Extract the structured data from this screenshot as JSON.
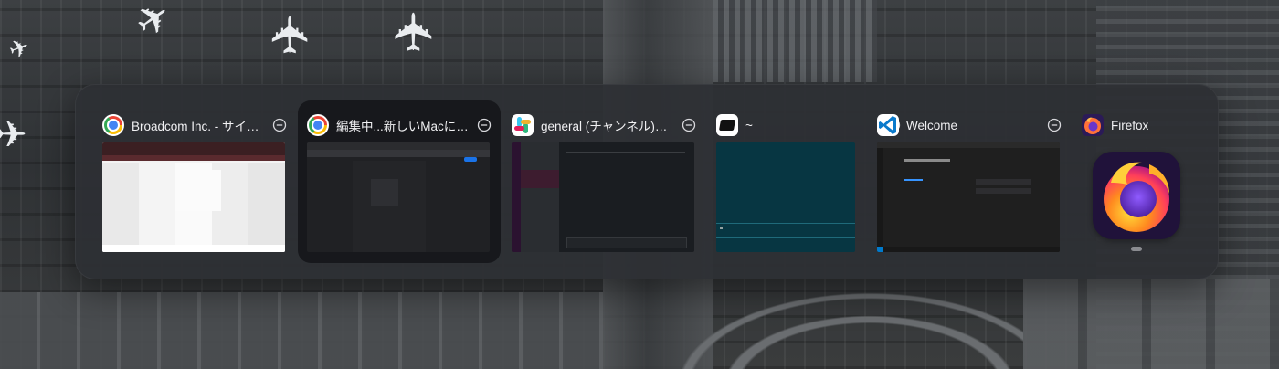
{
  "switcher": {
    "windows": [
      {
        "app": "Google Chrome",
        "title": "Broadcom Inc. - サイ…",
        "icon": "chrome-icon",
        "selected": false
      },
      {
        "app": "Google Chrome",
        "title": "編集中...新しいMacに…",
        "icon": "chrome-icon",
        "selected": true
      },
      {
        "app": "Slack",
        "title": "general (チャンネル)…",
        "icon": "slack-icon",
        "selected": false
      },
      {
        "app": "Terminal",
        "title": "~",
        "icon": "terminal-icon",
        "selected": false
      },
      {
        "app": "Visual Studio Code",
        "title": "Welcome",
        "icon": "vscode-icon",
        "selected": false
      },
      {
        "app": "Firefox",
        "title": "Firefox",
        "icon": "firefox-icon",
        "selected": false
      }
    ]
  },
  "colors": {
    "panel": "#2d2f34",
    "selected_tile": "#16171a",
    "terminal_bg": "#073642",
    "slack_sidebar": "#3f0e40",
    "vscode_blue": "#007acc",
    "firefox_orange": "#ff7139"
  }
}
